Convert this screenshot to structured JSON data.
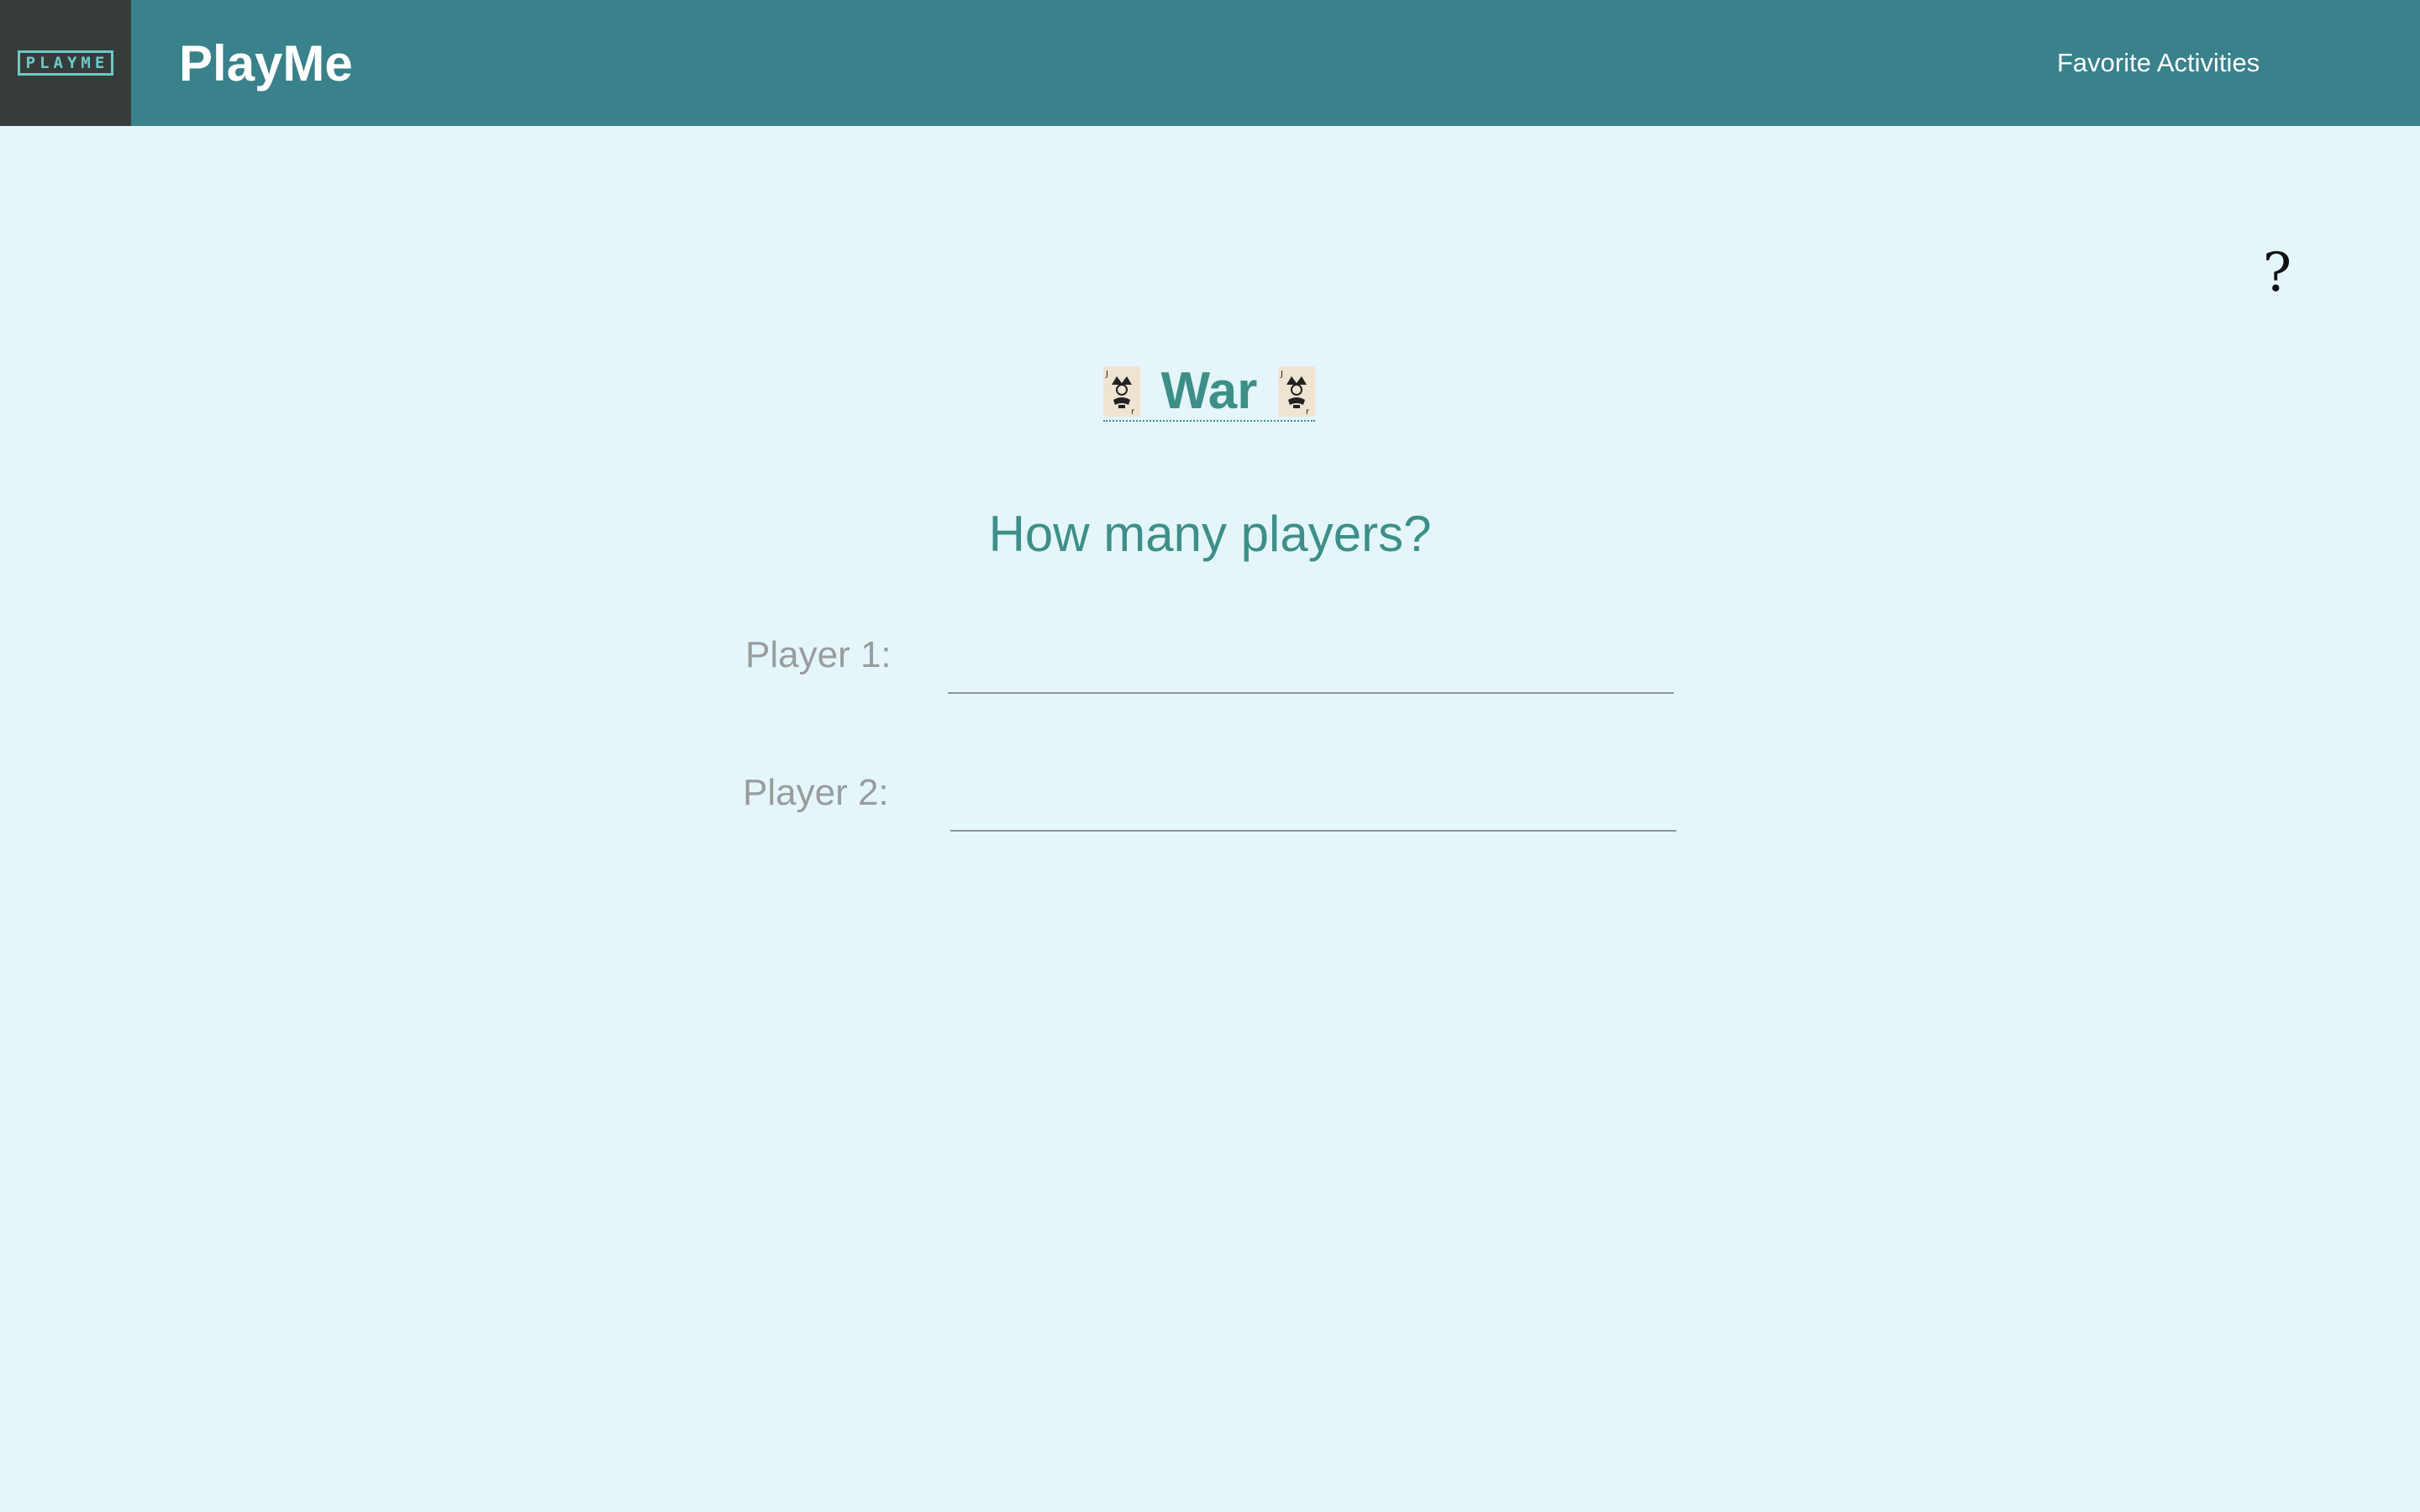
{
  "header": {
    "logo_text": "PLAYME",
    "brand": "PlayMe",
    "nav_link": "Favorite Activities"
  },
  "help_symbol": "?",
  "game": {
    "title": "War",
    "card_icon": "jack-playing-card-icon"
  },
  "question": "How many players?",
  "players": [
    {
      "label": "Player 1:",
      "value": ""
    },
    {
      "label": "Player 2:",
      "value": ""
    }
  ],
  "colors": {
    "header_bg": "#39818b",
    "logo_bg": "#353c3b",
    "page_bg": "#e4f6fa",
    "accent": "#3d8f88",
    "label_gray": "#999c9d"
  }
}
